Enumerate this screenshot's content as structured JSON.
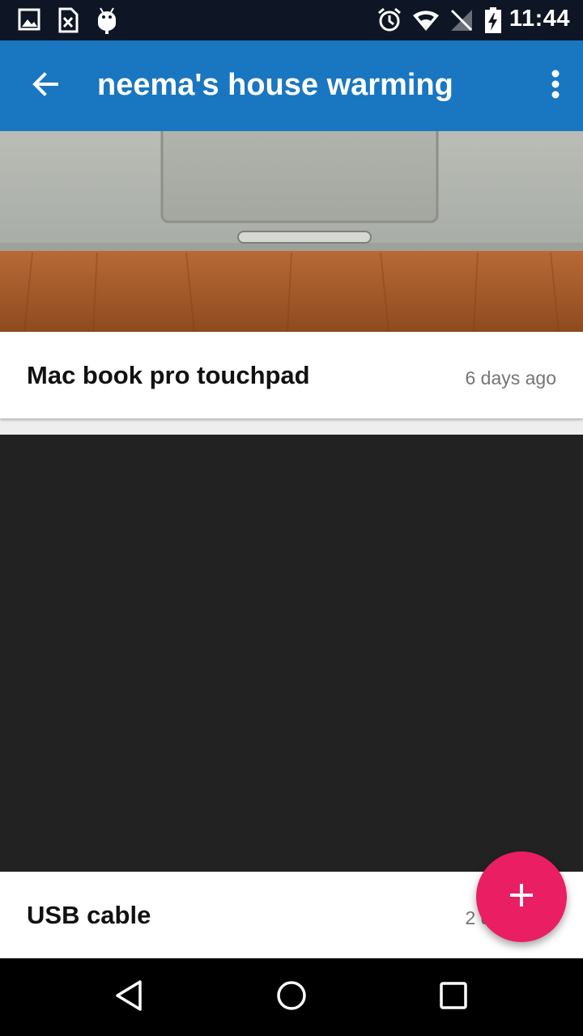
{
  "status_bar": {
    "time": "11:44",
    "left_icons": [
      "image-icon",
      "sim-card-off-icon",
      "android-icon"
    ],
    "right_icons": [
      "alarm-icon",
      "wifi-icon",
      "no-signal-icon",
      "battery-charging-icon"
    ]
  },
  "app_bar": {
    "title": "neema's house warming",
    "back_icon": "arrow-back-icon",
    "menu_icon": "more-vert-icon",
    "color": "#1976c0"
  },
  "items": [
    {
      "title": "Mac book pro touchpad",
      "time": "6 days ago"
    },
    {
      "title": "USB cable",
      "time": "2 days ago"
    }
  ],
  "fab": {
    "icon": "plus-icon",
    "color": "#e91e63"
  },
  "nav_bar": {
    "buttons": [
      "back-triangle-icon",
      "home-circle-icon",
      "recents-square-icon"
    ]
  }
}
